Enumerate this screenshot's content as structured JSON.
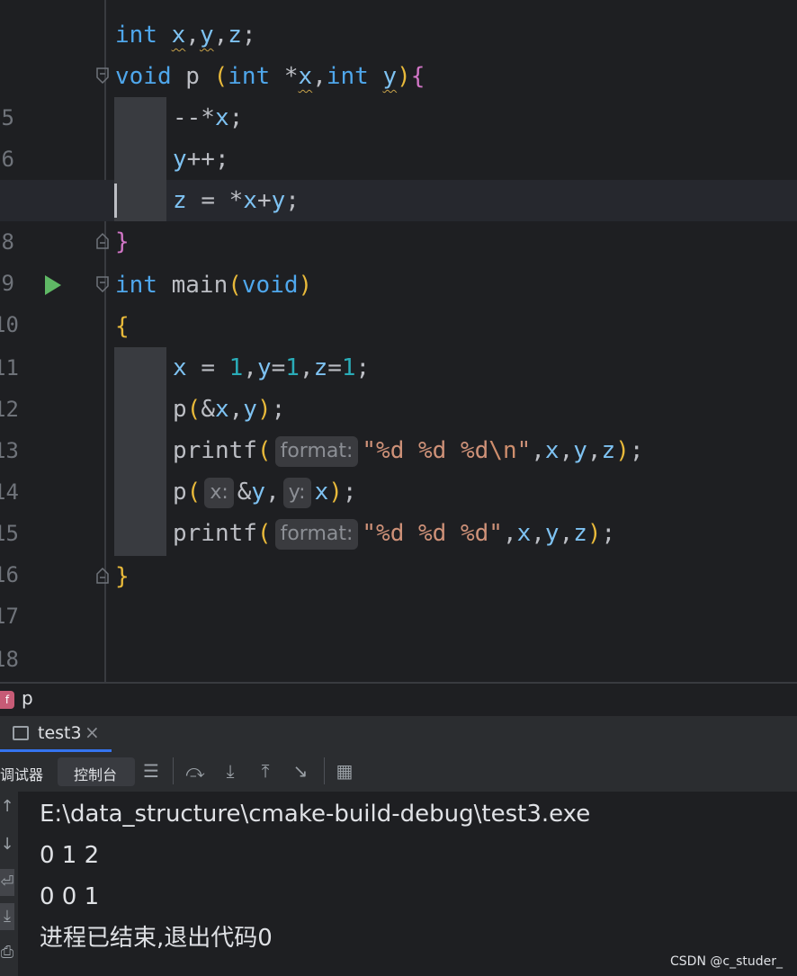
{
  "editor": {
    "line_numbers": [
      "5",
      "6",
      "7",
      "8",
      "9",
      "10",
      "11",
      "12",
      "13",
      "14",
      "15",
      "16",
      "17",
      "18"
    ],
    "hints": {
      "format": "format:",
      "x": "x:",
      "y": "y:"
    }
  },
  "breadcrumb": {
    "badge": "f",
    "name": "p"
  },
  "run_panel": {
    "tab_label": "test3",
    "tab_close": "×",
    "toolbar_debugger_label": "调试器",
    "toolbar_console_label": "控制台"
  },
  "console": {
    "lines": [
      "E:\\data_structure\\cmake-build-debug\\test3.exe",
      "0 1 2",
      "0 0 1",
      "进程已结束,退出代码0"
    ]
  },
  "watermark": "CSDN @c_studer_",
  "icons": {
    "run": "run-gutter-icon",
    "fold": "fold-icon",
    "function_badge": "function-icon",
    "console_tab": "console-icon",
    "close": "close-icon"
  },
  "colors": {
    "background": "#1e1f22",
    "keyword": "#4fa7ec",
    "number": "#2aacb8",
    "string": "#ce9178",
    "bracket": "#e8b93a",
    "run_green": "#5fb865",
    "tab_underline": "#3574f0"
  }
}
